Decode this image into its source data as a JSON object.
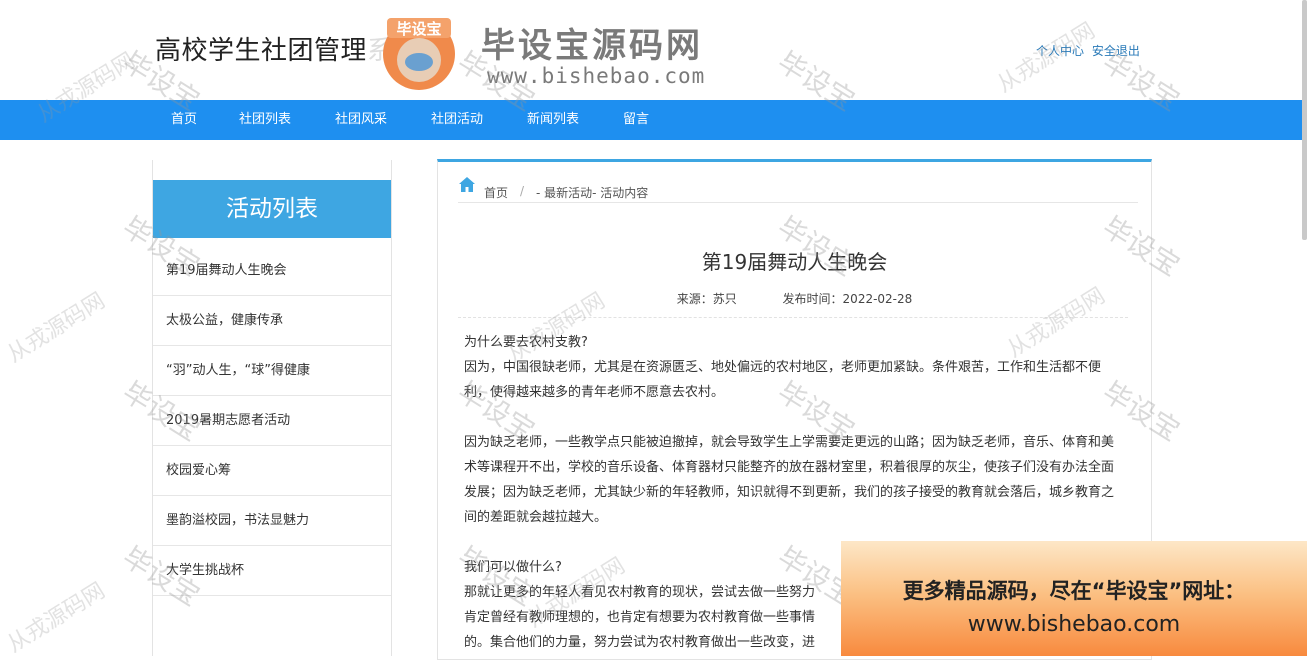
{
  "header": {
    "title": "高校学生社团管理系统",
    "user_center": "个人中心",
    "logout": "安全退出"
  },
  "logo": {
    "badge_text": "毕设宝",
    "site_name": "毕设宝源码网",
    "url": "www.bishebao.com"
  },
  "nav": {
    "items": [
      "首页",
      "社团列表",
      "社团风采",
      "社团活动",
      "新闻列表",
      "留言"
    ]
  },
  "sidebar": {
    "title": "活动列表",
    "items": [
      "第19届舞动人生晚会",
      "太极公益，健康传承",
      "“羽”动人生，“球”得健康",
      "2019暑期志愿者活动",
      "校园爱心筹",
      "墨韵溢校园，书法显魅力",
      "大学生挑战杯"
    ]
  },
  "breadcrumb": {
    "home": "首页",
    "sep": "/",
    "current": "- 最新活动- 活动内容"
  },
  "article": {
    "title": "第19届舞动人生晚会",
    "source": "来源：苏只",
    "publish_time": "发布时间：2022-02-28",
    "paragraphs": [
      "为什么要去农村支教?",
      "因为，中国很缺老师，尤其是在资源匮乏、地处偏远的农村地区，老师更加紧缺。条件艰苦，工作和生活都不便利，使得越来越多的青年老师不愿意去农村。",
      "因为缺乏老师，一些教学点只能被迫撤掉，就会导致学生上学需要走更远的山路；因为缺乏老师，音乐、体育和美术等课程开不出，学校的音乐设备、体育器材只能整齐的放在器材室里，积着很厚的灰尘，使孩子们没有办法全面发展；因为缺乏老师，尤其缺少新的年轻教师，知识就得不到更新，我们的孩子接受的教育就会落后，城乡教育之间的差距就会越拉越大。",
      "我们可以做什么?",
      "那就让更多的年轻人看见农村教育的现状，尝试去做一些努力",
      "肯定曾经有教师理想的，也肯定有想要为农村教育做一些事情",
      "的。集合他们的力量，努力尝试为农村教育做出一些改变，进"
    ]
  },
  "watermarks": {
    "a": "毕设宝",
    "b": "从戎源码网"
  },
  "banner": {
    "line1": "更多精品源码，尽在“毕设宝”网址：",
    "line2": "www.bishebao.com"
  }
}
